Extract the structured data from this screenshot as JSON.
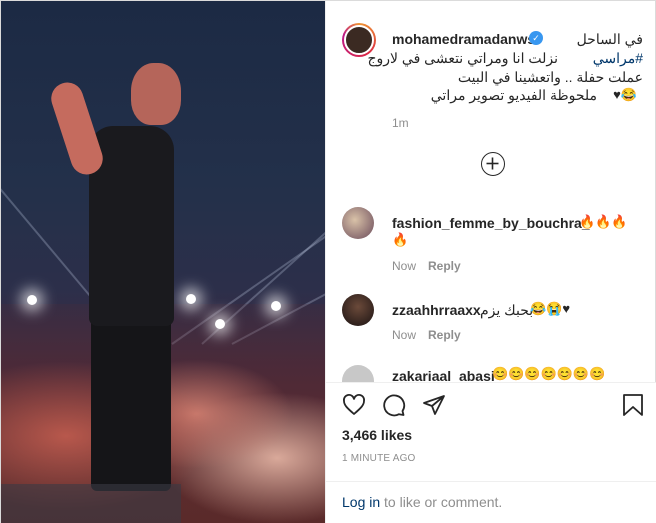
{
  "post": {
    "username": "mohamedramadanws",
    "verified_badge": "✓",
    "caption_lines": [
      "في الساحل",
      "نزلت انا ومراتي نتعشى في لاروج",
      "#مراسي",
      "عملت حفلة .. واتعشينا في البيت",
      "ملحوظة الفيديو تصوير مراتي",
      "😂♥"
    ],
    "caption_time": "1m"
  },
  "comments": [
    {
      "username": "fashion_femme_by_bouchra_",
      "text": "🔥🔥🔥",
      "text2": "🔥",
      "time": "Now",
      "reply_label": "Reply"
    },
    {
      "username": "zzaahhrraaxx",
      "text": "بحبك يزم",
      "emoji": "😂😭♥",
      "time": "Now",
      "reply_label": "Reply"
    },
    {
      "username": "zakariaal_abasi",
      "emoji": "😊😊😊😊😊😊😊"
    }
  ],
  "actions": {
    "likes": "3,466 likes",
    "posted_ago": "1 MINUTE AGO",
    "login_link": "Log in",
    "login_suffix": "to like or comment."
  },
  "colors": {
    "link": "#00376b",
    "muted": "#8e8e8e",
    "verified": "#3897f0"
  }
}
